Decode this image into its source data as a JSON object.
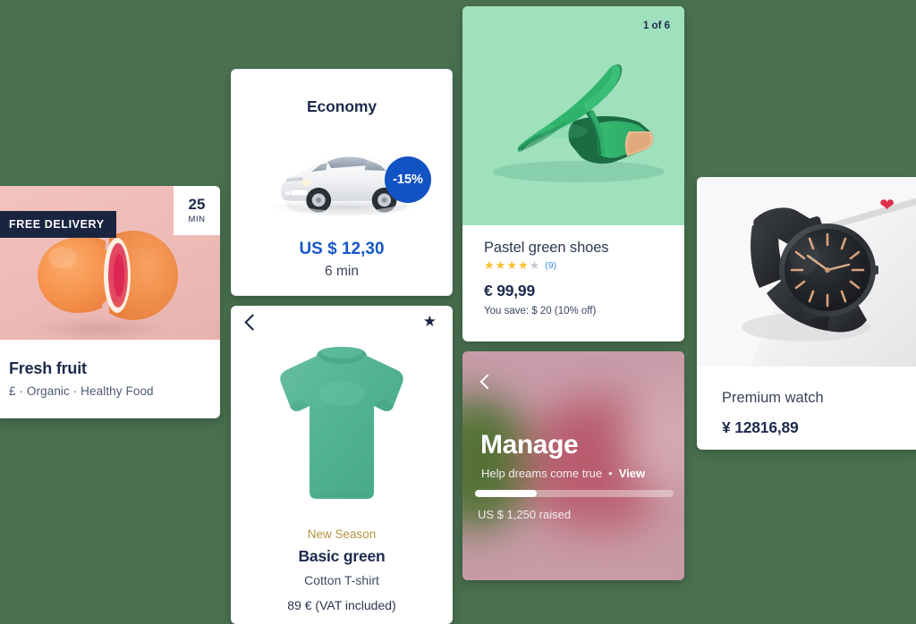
{
  "background_color": "#4a7250",
  "cards": {
    "fruit": {
      "badge_free_delivery": "FREE DELIVERY",
      "eta_number": "25",
      "eta_unit": "MIN",
      "title": "Fresh fruit",
      "meta": "£  ·  Organic  ·  Healthy Food"
    },
    "economy": {
      "title": "Economy",
      "discount": "-15%",
      "price": "US $ 12,30",
      "time": "6 min",
      "accent_color": "#1657c6"
    },
    "tshirt": {
      "tag": "New Season",
      "title": "Basic green",
      "subtitle": "Cotton T-shirt",
      "price": "89 € (VAT included)",
      "back_icon": "chevron-left-icon",
      "fav_icon": "star-icon",
      "tag_color": "#b59340"
    },
    "shoes": {
      "counter": "1 of 6",
      "title": "Pastel green shoes",
      "stars_filled": 4,
      "stars_total": 5,
      "review_count": "(9)",
      "price": "€ 99,99",
      "savings": "You save: $ 20 (10% off)",
      "image_bg": "#9fe0bd",
      "star_on_color": "#fbc02d",
      "star_off_color": "#c3c9d2",
      "review_link_color": "#3e8ee0"
    },
    "manage": {
      "back_icon": "chevron-left-icon",
      "title": "Manage",
      "subtitle": "Help dreams come true",
      "separator": "•",
      "view_label": "View",
      "progress_percent": 31,
      "raised": "US $ 1,250 raised"
    },
    "watch": {
      "fav_icon": "heart-icon",
      "heart_color": "#e02f4e",
      "title": "Premium watch",
      "price": "¥ 12816,89"
    }
  }
}
